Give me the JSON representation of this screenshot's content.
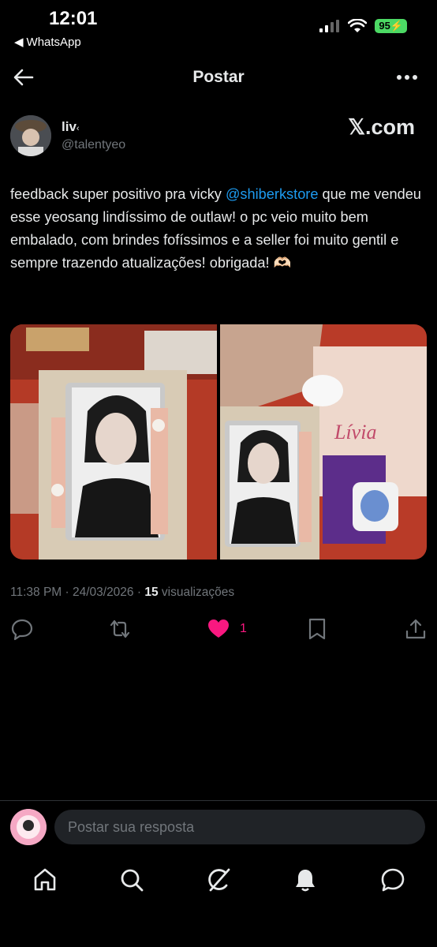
{
  "status_bar": {
    "time": "12:01",
    "back_app": "WhatsApp",
    "battery": "95"
  },
  "header": {
    "title": "Postar"
  },
  "post": {
    "author_name": "liv",
    "author_handle": "@talentyeo",
    "source_brand": "𝕏.com",
    "text_before": "feedback super positivo pra vicky ",
    "mention": "@shiberkstore",
    "text_after": " que me vendeu esse yeosang lindíssimo de outlaw! o pc veio muito bem embalado, com brindes fofíssimos e a seller foi muito gentil e sempre trazendo atualizações! obrigada! 🫶🏻",
    "timestamp": "11:38 PM · 24/03/2026 · ",
    "views_count": "15",
    "views_label": " visualizações",
    "like_count": "1",
    "liked": true
  },
  "media": [
    {
      "label": "photo-1",
      "description": ""
    },
    {
      "label": "photo-2",
      "description": ""
    }
  ],
  "reply": {
    "placeholder": "Postar sua resposta"
  },
  "colors": {
    "accent": "#1d9bf0",
    "like": "#f91880",
    "background": "#000000",
    "muted": "#71767b"
  },
  "icons": [
    "back-arrow-icon",
    "more-icon",
    "reply-icon",
    "repost-icon",
    "heart-icon",
    "bookmark-icon",
    "share-icon",
    "home-icon",
    "search-icon",
    "grok-icon",
    "bell-icon",
    "messages-icon"
  ]
}
